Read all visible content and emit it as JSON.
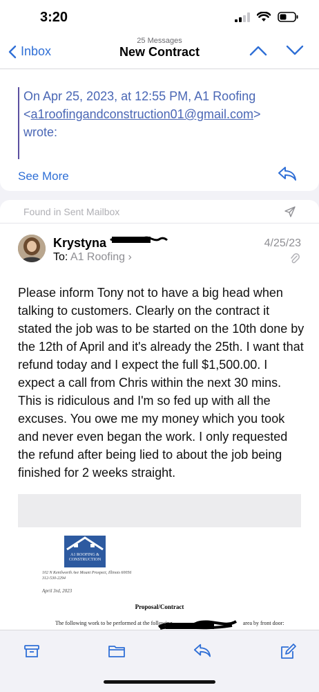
{
  "status_bar": {
    "time": "3:20"
  },
  "nav": {
    "back_label": "Inbox",
    "message_count": "25 Messages",
    "title": "New Contract"
  },
  "quoted": {
    "line1": "On Apr 25, 2023, at 12:55 PM, A1 Roofing",
    "email": "a1roofingandconstruction01@gmail.com",
    "line3": "wrote:",
    "see_more": "See More"
  },
  "message": {
    "found_label": "Found in Sent Mailbox",
    "sender": "Krystyna",
    "to_label": "To:",
    "to_value": "A1 Roofing",
    "date": "4/25/23",
    "body": "Please inform Tony not to have a big head when talking to customers. Clearly on the contract it stated the job was to be started on the 10th done by the 12th of April and it's already the 25th. I want that refund today and I expect the full $1,500.00. I expect a call from Chris within the next 30 mins. This is ridiculous and I'm so fed up with all the excuses. You owe me my money which you took and never even began the work. I only requested the refund after being lied to about the job being finished for 2 weeks straight."
  },
  "attachment": {
    "logo_text_1": "A1 ROOFING &",
    "logo_text_2": "CONSTRUCTION",
    "address_line_1": "102 N Kenilworth Ave Mount Prospect, Illinois 60056",
    "address_line_2": "312-530-2294",
    "date": "April 3rd, 2023",
    "title": "Proposal/Contract",
    "line_start": "The following work to be performed at the following",
    "line_end": "area by front door:"
  },
  "colors": {
    "accent_blue": "#2f6fd6",
    "quote_text": "#4a67b5",
    "quote_bar": "#5b4fa0",
    "logo_blue": "#2d5aa0"
  },
  "icons": {
    "back": "chevron-left-icon",
    "up": "chevron-up-icon",
    "down": "chevron-down-icon",
    "reply": "reply-arrow-icon",
    "sent": "paper-plane-icon",
    "attachment": "paperclip-icon",
    "archive": "archive-box-icon",
    "folder": "folder-icon",
    "compose": "compose-icon"
  }
}
